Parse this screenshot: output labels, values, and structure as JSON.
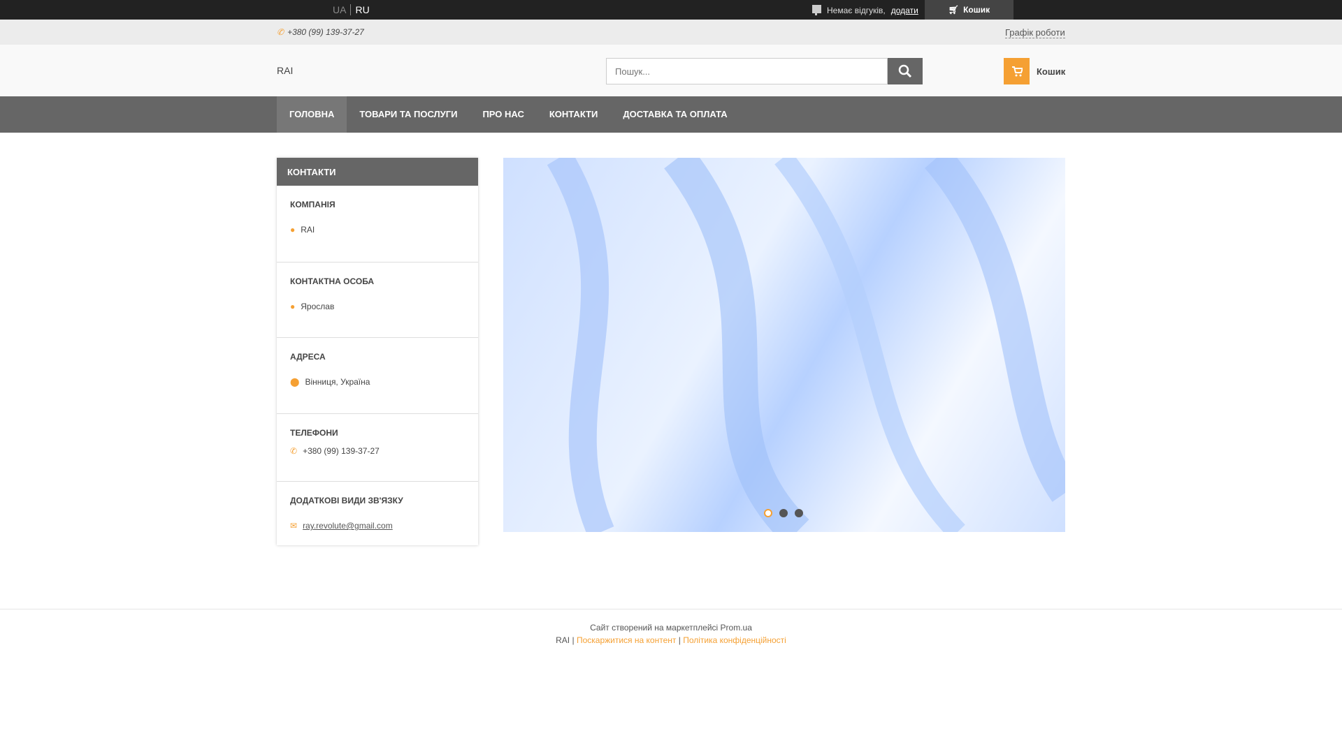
{
  "topbar": {
    "lang_ua": "UA",
    "lang_ru": "RU",
    "reviews_text": "Немає відгуків,",
    "reviews_link": "додати",
    "cart_label": "Кошик"
  },
  "phonebar": {
    "phone": "+380 (99) 139-37-27",
    "schedule": "Графік роботи"
  },
  "header": {
    "logo": "RAI",
    "search_placeholder": "Пошук...",
    "cart_label": "Кошик"
  },
  "nav": [
    "ГОЛОВНА",
    "ТОВАРИ ТА ПОСЛУГИ",
    "ПРО НАС",
    "КОНТАКТИ",
    "ДОСТАВКА ТА ОПЛАТА"
  ],
  "sidebar": {
    "title": "КОНТАКТИ",
    "sections": [
      {
        "title": "КОМПАНІЯ",
        "value": "RAI"
      },
      {
        "title": "КОНТАКТНА ОСОБА",
        "value": "Ярослав"
      },
      {
        "title": "АДРЕСА",
        "value": "Вінниця, Україна"
      },
      {
        "title": "ТЕЛЕФОНИ",
        "value": "+380 (99) 139-37-27"
      },
      {
        "title": "ДОДАТКОВІ ВИДИ ЗВ'ЯЗКУ",
        "value": "ray.revolute@gmail.com"
      }
    ]
  },
  "banner": {
    "slides": 3,
    "active": 1
  },
  "footer": {
    "line1": "Сайт створений на маркетплейсі Prom.ua",
    "company": "RAI",
    "sep": "|",
    "complaint": "Поскаржитися на контент",
    "privacy": "Політика конфіденційності"
  },
  "colors": {
    "accent": "#f5a033",
    "nav": "#666666",
    "topbar": "#222222"
  }
}
